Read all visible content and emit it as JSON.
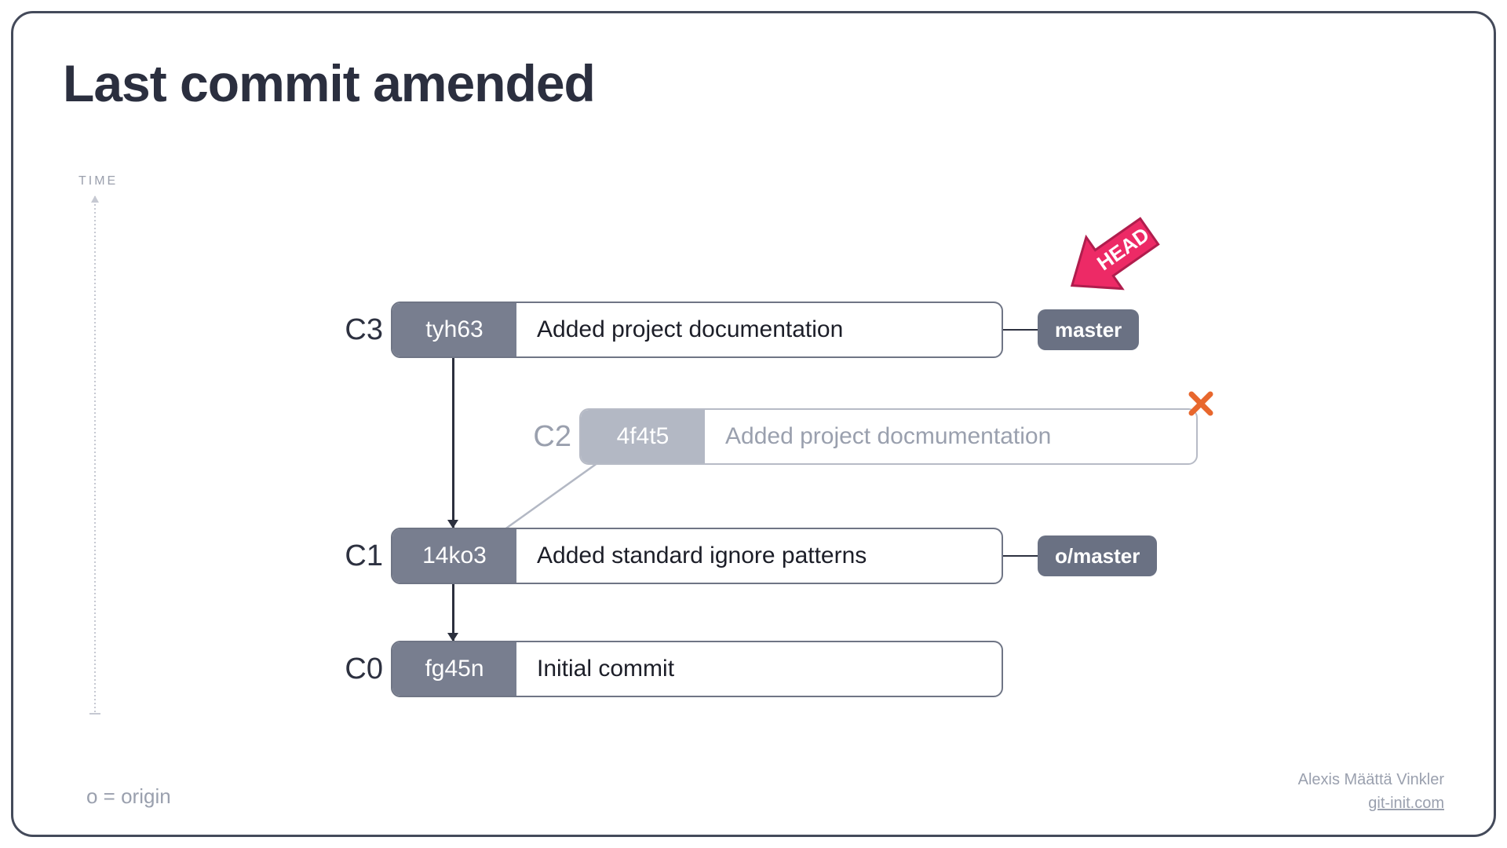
{
  "title": "Last commit amended",
  "timeLabel": "TIME",
  "commits": {
    "c3": {
      "label": "C3",
      "hash": "tyh63",
      "message": "Added project documentation",
      "branch": "master"
    },
    "c2": {
      "label": "C2",
      "hash": "4f4t5",
      "message": "Added project docmumentation"
    },
    "c1": {
      "label": "C1",
      "hash": "14ko3",
      "message": "Added standard ignore patterns",
      "branch": "o/master"
    },
    "c0": {
      "label": "C0",
      "hash": "fg45n",
      "message": "Initial commit"
    }
  },
  "headLabel": "HEAD",
  "legend": "o = origin",
  "author": "Alexis Määttä Vinkler",
  "site": "git-init.com"
}
